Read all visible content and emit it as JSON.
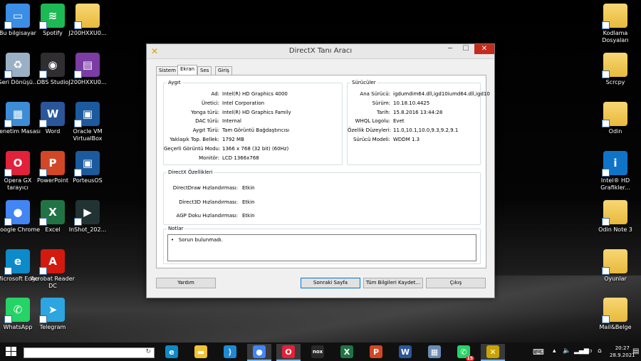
{
  "desktop": {
    "icons_left": [
      {
        "label": "Bu bilgisayar",
        "icon": "computer-icon"
      },
      {
        "label": "Spotify",
        "icon": "spotify-icon"
      },
      {
        "label": "J200HXXU0...",
        "icon": "folder-icon"
      },
      {
        "label": "Geri Dönüşü...",
        "icon": "recycle-bin-icon"
      },
      {
        "label": "OBS Studio",
        "icon": "obs-icon"
      },
      {
        "label": "J200HXXU0...",
        "icon": "winrar-icon"
      },
      {
        "label": "Denetim Masası",
        "icon": "control-panel-icon"
      },
      {
        "label": "Word",
        "icon": "word-icon"
      },
      {
        "label": "Oracle VM VirtualBox",
        "icon": "virtualbox-icon"
      },
      {
        "label": "Opera GX tarayıcı",
        "icon": "opera-gx-icon"
      },
      {
        "label": "PowerPoint",
        "icon": "powerpoint-icon"
      },
      {
        "label": "PorteusOS",
        "icon": "virtualbox-icon"
      },
      {
        "label": "Google Chrome",
        "icon": "chrome-icon"
      },
      {
        "label": "Excel",
        "icon": "excel-icon"
      },
      {
        "label": "InShot_202...",
        "icon": "video-file-icon"
      },
      {
        "label": "Microsoft Edge",
        "icon": "edge-icon"
      },
      {
        "label": "Acrobat Reader DC",
        "icon": "acrobat-icon"
      },
      {
        "label": "WhatsApp",
        "icon": "whatsapp-icon"
      },
      {
        "label": "Telegram",
        "icon": "telegram-icon"
      }
    ],
    "icons_right": [
      {
        "label": "Kodlama Dosyaları",
        "icon": "folder-icon"
      },
      {
        "label": "Scrcpy",
        "icon": "folder-icon"
      },
      {
        "label": "Odin",
        "icon": "folder-icon"
      },
      {
        "label": "Intel® HD Grafikler...",
        "icon": "intel-graphics-icon"
      },
      {
        "label": "Odin Note 3",
        "icon": "folder-icon"
      },
      {
        "label": "Oyunlar",
        "icon": "folder-icon"
      },
      {
        "label": "Mail&Belge",
        "icon": "folder-icon"
      }
    ]
  },
  "window": {
    "title": "DirectX Tanı Aracı",
    "tabs": [
      "Sistem",
      "Ekran",
      "Ses",
      "Giriş"
    ],
    "active_tab": "Ekran",
    "device": {
      "legend": "Aygıt",
      "rows": [
        {
          "k": "Ad:",
          "v": "Intel(R) HD Graphics 4000"
        },
        {
          "k": "Üretici:",
          "v": "Intel Corporation"
        },
        {
          "k": "Yonga türü:",
          "v": "Intel(R) HD Graphics Family"
        },
        {
          "k": "DAC türü:",
          "v": "Internal"
        },
        {
          "k": "Aygıt Türü:",
          "v": "Tam Görüntü Bağdaştırıcısı"
        },
        {
          "k": "Yaklaşık Top. Bellek:",
          "v": "1792 MB"
        },
        {
          "k": "Geçerli Görüntü Modu:",
          "v": "1366 x 768 (32 bit) (60Hz)"
        },
        {
          "k": "Monitör:",
          "v": "LCD 1366x768"
        }
      ]
    },
    "drivers": {
      "legend": "Sürücüler",
      "rows": [
        {
          "k": "Ana Sürücü:",
          "v": "igdumdim64.dll,igd10iumd64.dll,igd10"
        },
        {
          "k": "Sürüm:",
          "v": "10.18.10.4425"
        },
        {
          "k": "Tarih:",
          "v": "15.8.2016 13:44:28"
        },
        {
          "k": "WHQL Logolu:",
          "v": "Evet"
        },
        {
          "k": "Özellik Düzeyleri:",
          "v": "11.0,10.1,10.0,9.3,9.2,9.1"
        },
        {
          "k": "Sürücü Modeli:",
          "v": "WDDM 1.3"
        }
      ]
    },
    "features": {
      "legend": "DirectX Özellikleri",
      "rows": [
        {
          "k": "DirectDraw Hızlandırması:",
          "v": "Etkin"
        },
        {
          "k": "Direct3D Hızlandırması:",
          "v": "Etkin"
        },
        {
          "k": "AGP Doku Hızlandırması:",
          "v": "Etkin"
        }
      ]
    },
    "notes": {
      "legend": "Notlar",
      "items": [
        "Sorun bulunmadı."
      ]
    },
    "buttons": {
      "help": "Yardım",
      "next": "Sonraki Sayfa",
      "save_all": "Tüm Bilgileri Kaydet...",
      "exit": "Çıkış"
    }
  },
  "taskbar": {
    "apps": [
      "edge-icon",
      "file-explorer-icon",
      "vscode-icon",
      "chrome-icon",
      "opera-gx-icon",
      "nox-icon",
      "excel-icon",
      "powerpoint-icon",
      "word-icon",
      "control-panel-icon",
      "whatsapp-icon",
      "directx-icon"
    ],
    "whatsapp_badge": "15",
    "time": "20:27",
    "date": "28.9.2021"
  }
}
